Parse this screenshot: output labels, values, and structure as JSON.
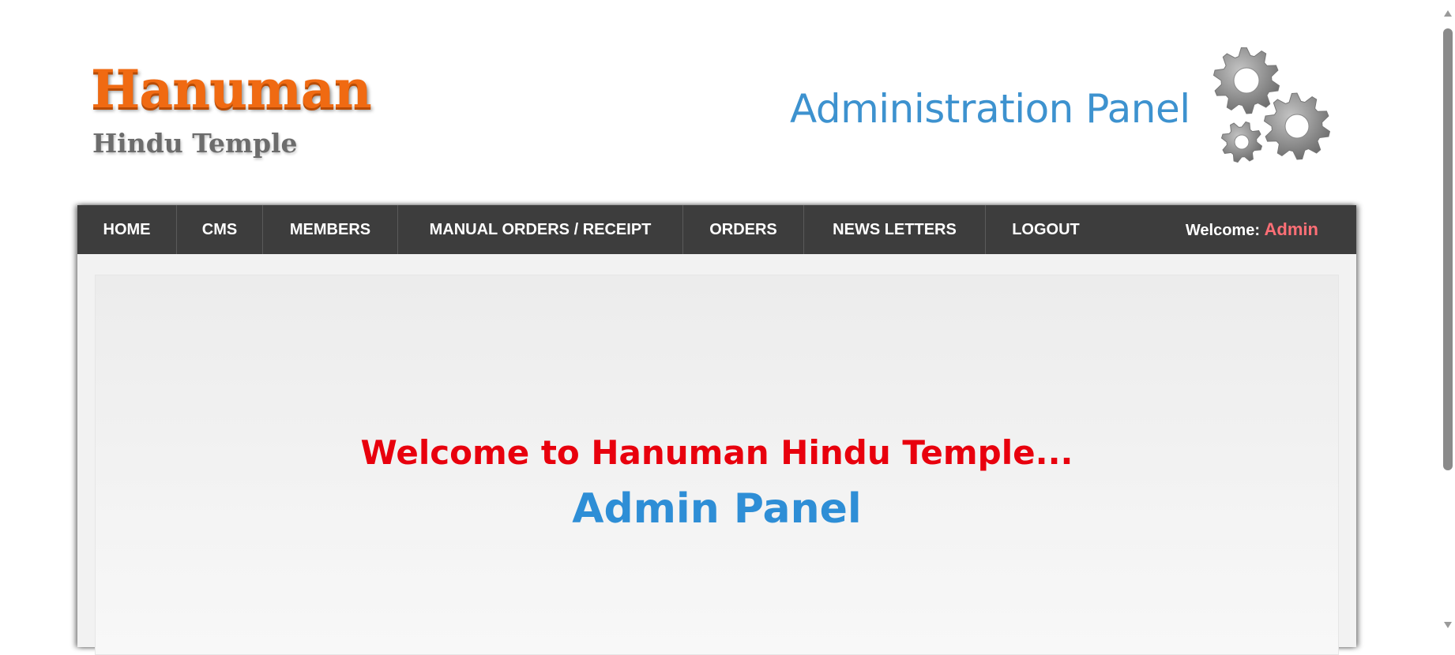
{
  "header": {
    "logo_main": "Hanuman",
    "logo_sub": "Hindu Temple",
    "admin_title": "Administration Panel",
    "gears_icon": "gears-icon"
  },
  "nav": {
    "items": [
      {
        "label": "HOME"
      },
      {
        "label": "CMS"
      },
      {
        "label": "MEMBERS"
      },
      {
        "label": "MANUAL ORDERS / RECEIPT"
      },
      {
        "label": "ORDERS"
      },
      {
        "label": "NEWS LETTERS"
      },
      {
        "label": "LOGOUT"
      }
    ],
    "welcome_label": "Welcome:",
    "welcome_user": "Admin"
  },
  "main": {
    "welcome_text": "Welcome to Hanuman Hindu Temple...",
    "panel_text": "Admin Panel"
  },
  "colors": {
    "logo_orange": "#f06a12",
    "title_blue": "#3d92cf",
    "nav_background": "#3d3d3d",
    "welcome_red": "#e8000d",
    "panel_blue": "#2e8ed6",
    "admin_pink": "#ff6f76"
  }
}
